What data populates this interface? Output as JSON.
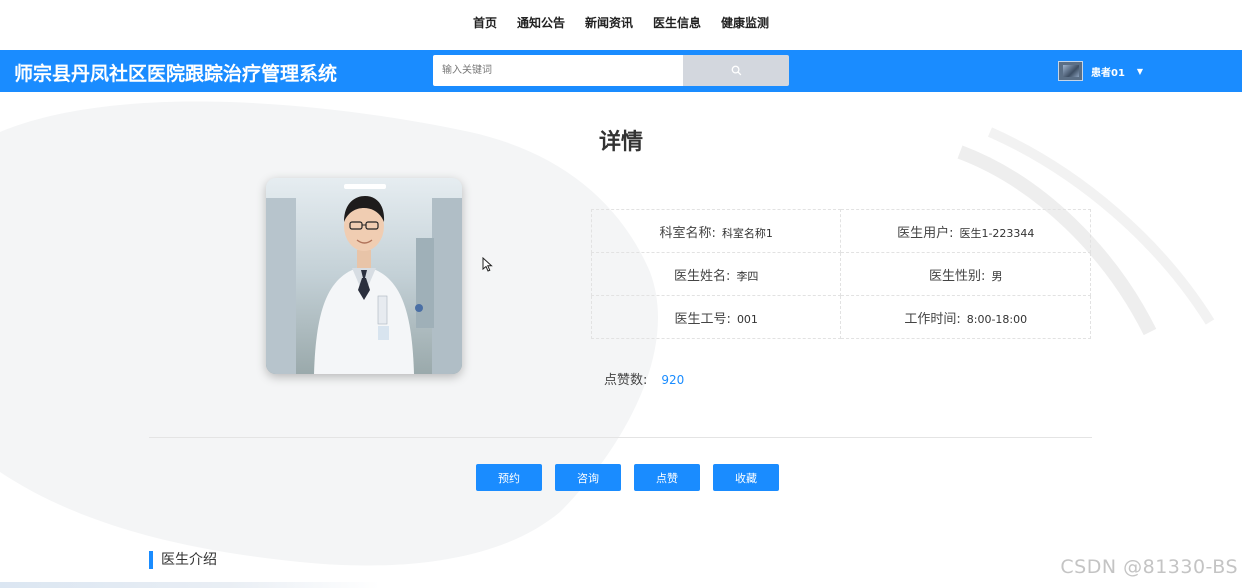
{
  "topnav": {
    "items": [
      "首页",
      "通知公告",
      "新闻资讯",
      "医生信息",
      "健康监测"
    ]
  },
  "header": {
    "site_title": "师宗县丹凤社区医院跟踪治疗管理系统",
    "search_placeholder": "输入关键词",
    "user_name": "患者01",
    "accent_color": "#1a8cff"
  },
  "detail": {
    "title": "详情",
    "fields": [
      {
        "label": "科室名称:",
        "value": "科室名称1"
      },
      {
        "label": "医生用户:",
        "value": "医生1-223344"
      },
      {
        "label": "医生姓名:",
        "value": "李四"
      },
      {
        "label": "医生性别:",
        "value": "男"
      },
      {
        "label": "医生工号:",
        "value": "001"
      },
      {
        "label": "工作时间:",
        "value": "8:00-18:00"
      }
    ],
    "likes_label": "点赞数:",
    "likes_value": "920"
  },
  "actions": {
    "buttons": [
      "预约",
      "咨询",
      "点赞",
      "收藏"
    ]
  },
  "section": {
    "intro_title": "医生介绍"
  },
  "watermark": "CSDN @81330-BS"
}
